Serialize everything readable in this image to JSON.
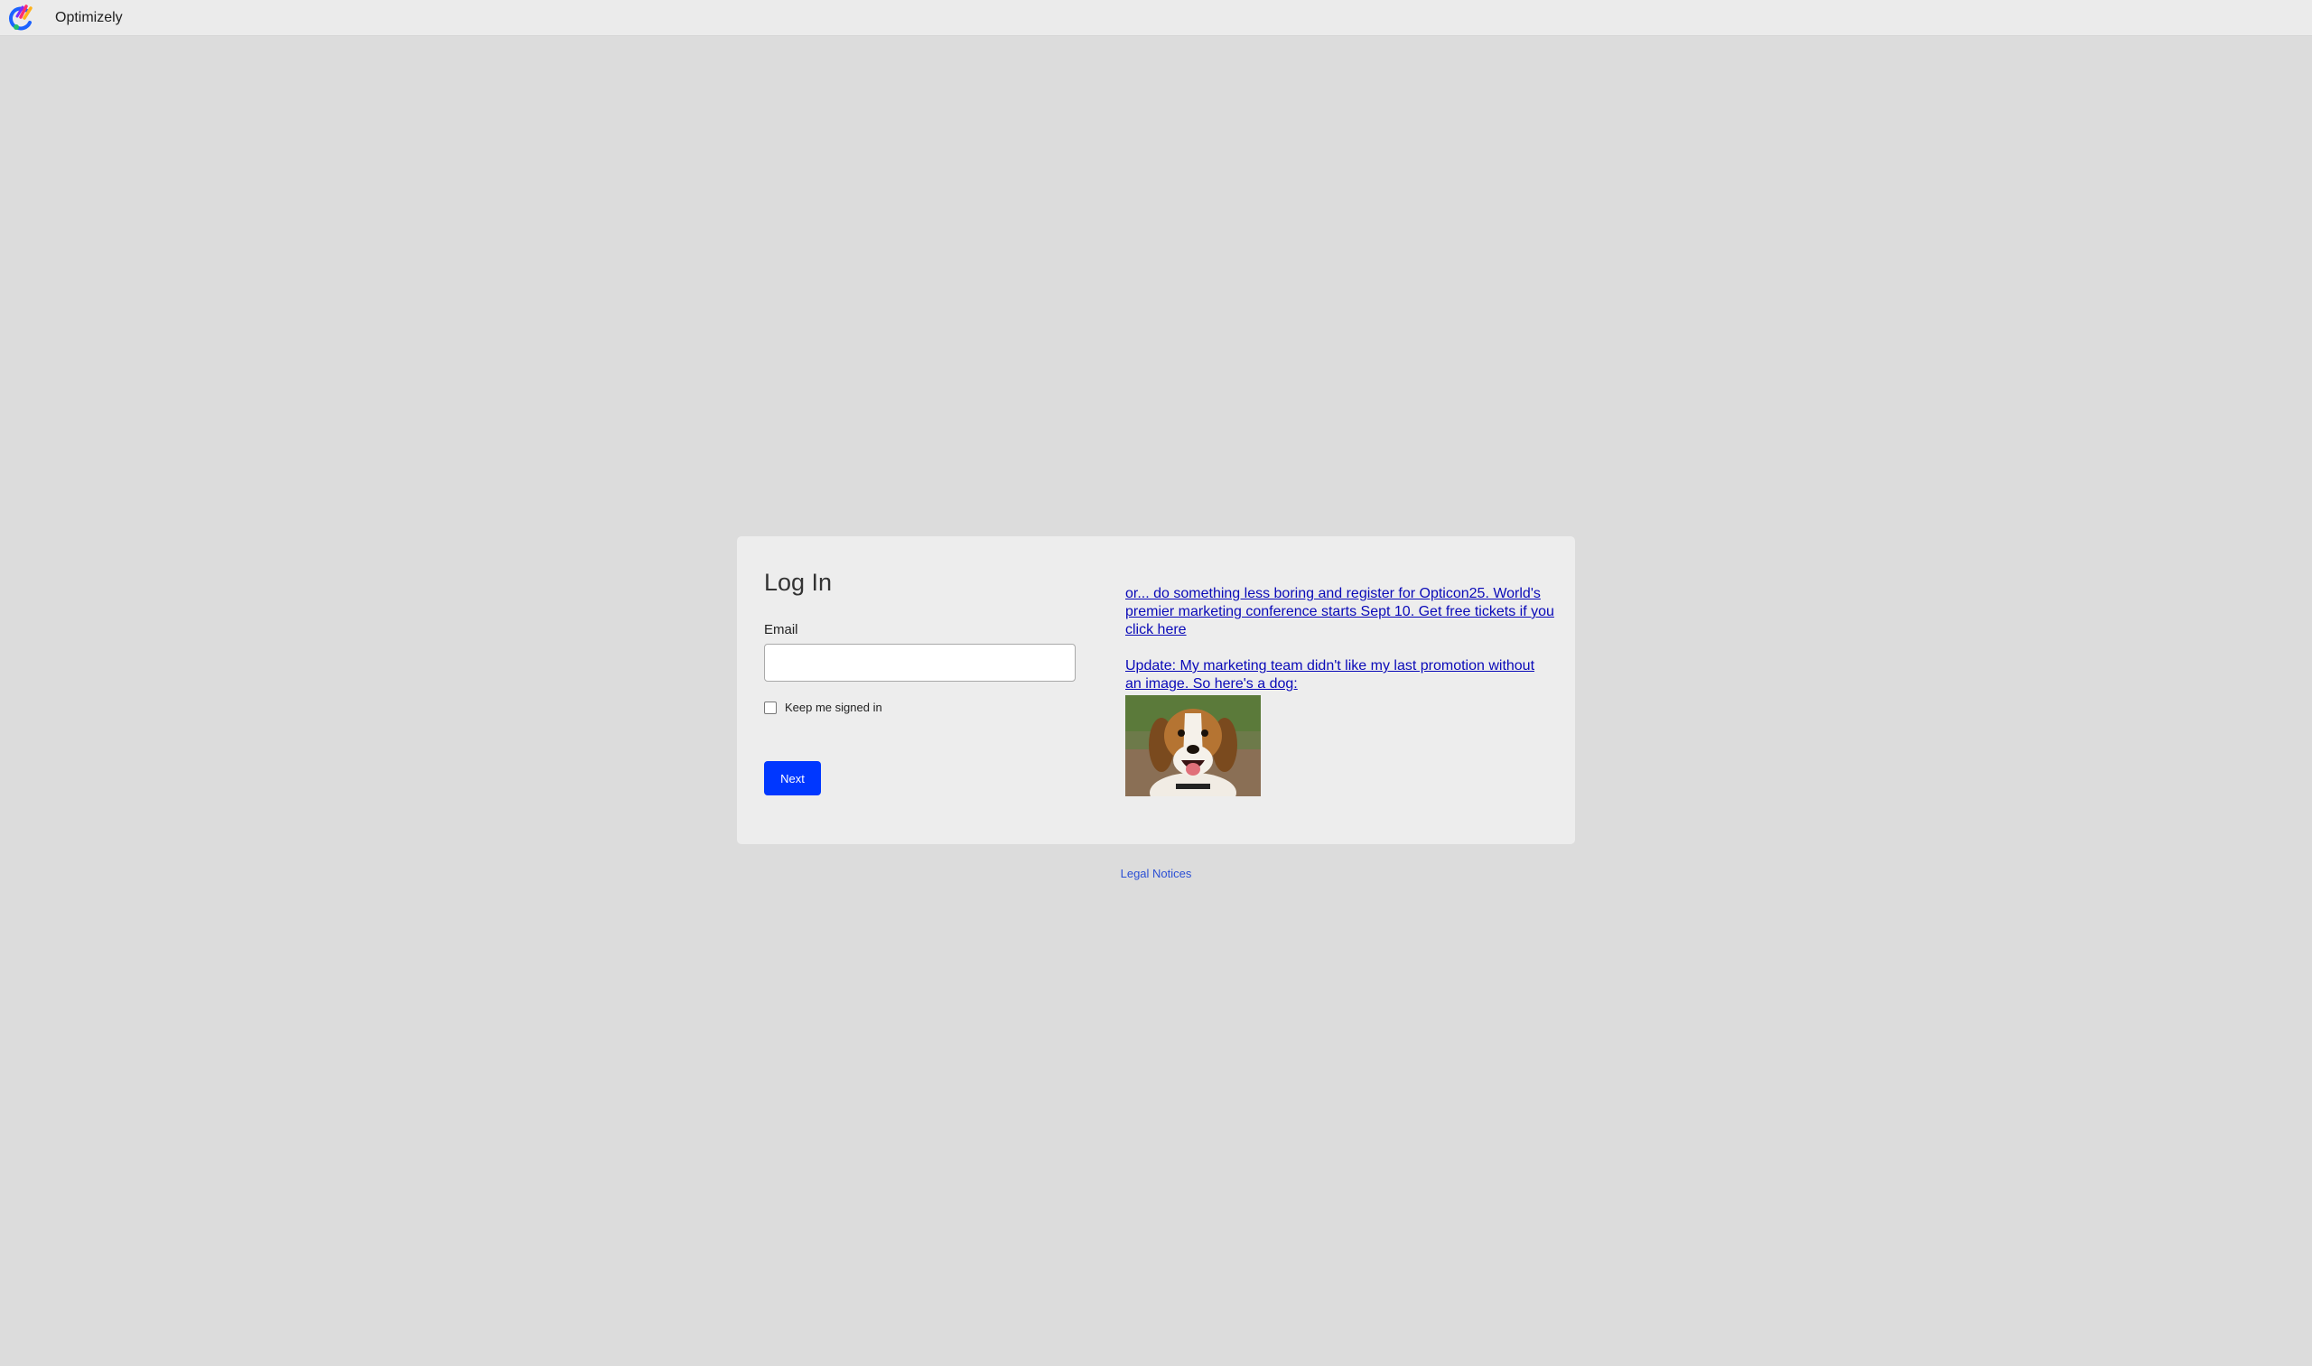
{
  "header": {
    "brand": "Optimizely",
    "logo_icon": "optimizely-logo-icon"
  },
  "login": {
    "title": "Log In",
    "email_label": "Email",
    "email_value": "",
    "email_placeholder": "",
    "keep_signed_in_label": "Keep me signed in",
    "keep_signed_in_checked": false,
    "next_label": "Next"
  },
  "promo": {
    "link1_text": "or... do something less boring and register for Opticon25. World's premier marketing conference starts Sept 10. Get free tickets if you click here",
    "link2_text": "Update: My marketing team didn't like my last promotion without an image. So here's a dog:",
    "image_icon": "beagle-dog-photo"
  },
  "footer": {
    "legal_label": "Legal Notices"
  },
  "colors": {
    "page_bg": "#dcdcdc",
    "card_bg": "#ededed",
    "primary_button": "#0037ff",
    "link": "#0a0ab8"
  }
}
